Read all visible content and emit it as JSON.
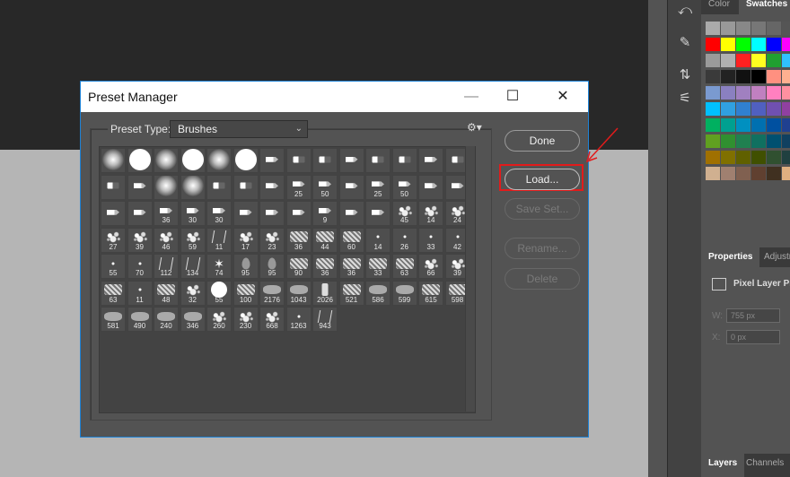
{
  "dialog": {
    "title": "Preset Manager",
    "preset_type_label": "Preset Type:",
    "preset_type_value": "Brushes",
    "buttons": {
      "done": "Done",
      "load": "Load...",
      "save_set": "Save Set...",
      "rename": "Rename...",
      "delete": "Delete"
    },
    "brush_numbers": [
      "",
      "",
      "",
      "",
      "",
      "",
      "",
      "",
      "",
      "",
      "",
      "",
      "",
      "",
      "",
      "",
      "",
      "",
      "",
      "",
      "",
      "25",
      "50",
      "",
      "25",
      "50",
      "",
      "",
      "",
      "",
      "36",
      "30",
      "30",
      "",
      "",
      "",
      "9",
      "",
      "",
      "45",
      "14",
      "24",
      "27",
      "39",
      "46",
      "59",
      "11",
      "17",
      "23",
      "36",
      "44",
      "60",
      "14",
      "26",
      "33",
      "42",
      "55",
      "70",
      "112",
      "134",
      "74",
      "95",
      "95",
      "90",
      "36",
      "36",
      "33",
      "63",
      "66",
      "39",
      "63",
      "11",
      "48",
      "32",
      "55",
      "100",
      "2176",
      "1043",
      "2026",
      "521",
      "586",
      "599",
      "615",
      "598",
      "581",
      "490",
      "240",
      "346",
      "260",
      "230",
      "668",
      "1263",
      "943"
    ]
  },
  "right_panel": {
    "tabs_top": [
      "Color",
      "Swatches"
    ],
    "properties_tabs": [
      "Properties",
      "Adjustments"
    ],
    "pixel_layer_label": "Pixel Layer Properties",
    "w_label": "W:",
    "w_value": "755 px",
    "x_label": "X:",
    "x_value": "0 px",
    "bottom_tabs": [
      "Layers",
      "Channels"
    ]
  },
  "colors": {
    "swatches": [
      "#aaaaaa",
      "#999999",
      "#888888",
      "#777777",
      "#666666",
      "#555555",
      "#ff0000",
      "#ffff00",
      "#00ff00",
      "#00ffff",
      "#0000ff",
      "#ff00ff",
      "#9a9a9a",
      "#b0b0b0",
      "#ff2020",
      "#ffff20",
      "#20a030",
      "#30c0ff",
      "#3a3a3a",
      "#222222",
      "#111111",
      "#000000",
      "#ff9080",
      "#ffb090",
      "#7a9ad0",
      "#8a80c0",
      "#a080c0",
      "#c080c0",
      "#ff80c0",
      "#ff90a0",
      "#00c0ff",
      "#30a0e0",
      "#3080d0",
      "#5060c0",
      "#7050b0",
      "#9040a0",
      "#00b060",
      "#00a090",
      "#0090c0",
      "#0070b0",
      "#0050a0",
      "#204090",
      "#60a020",
      "#309030",
      "#208050",
      "#107060",
      "#005070",
      "#104060",
      "#a07000",
      "#807000",
      "#606000",
      "#405000",
      "#305030",
      "#204040",
      "#d0b090",
      "#a08070",
      "#806050",
      "#604030",
      "#403020",
      "#e0b080"
    ]
  }
}
